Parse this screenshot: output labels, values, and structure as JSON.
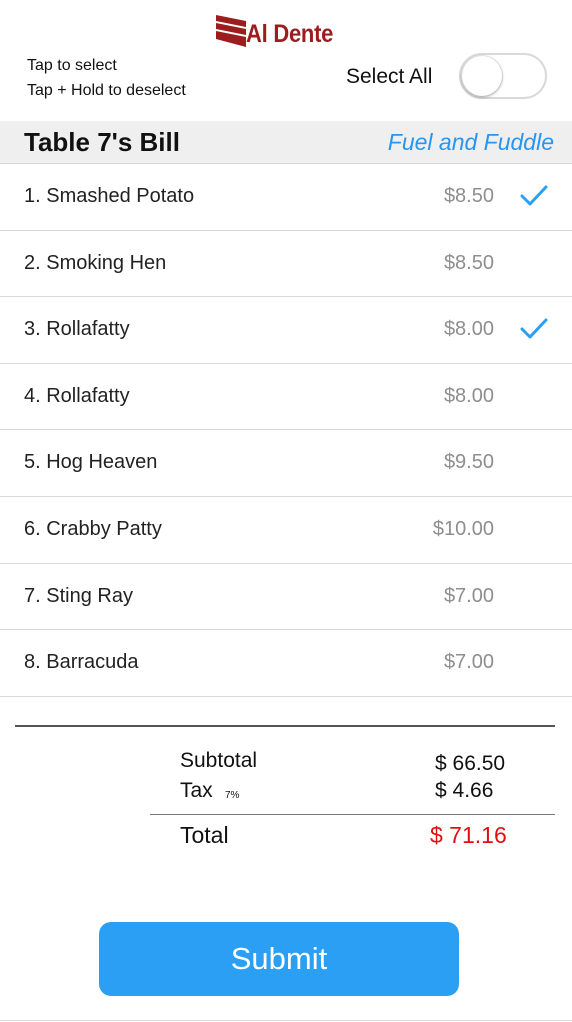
{
  "brand": {
    "name": "Al Dente",
    "color": "#9b1d1d"
  },
  "hints": {
    "select": "Tap to select",
    "deselect": "Tap + Hold to deselect"
  },
  "select_all": {
    "label": "Select All",
    "on": false
  },
  "bill": {
    "title": "Table 7's Bill",
    "restaurant": "Fuel and Fuddle"
  },
  "items": [
    {
      "label": "1. Smashed Potato",
      "price": "$8.50",
      "selected": true
    },
    {
      "label": "2. Smoking Hen",
      "price": "$8.50",
      "selected": false
    },
    {
      "label": "3. Rollafatty",
      "price": "$8.00",
      "selected": true
    },
    {
      "label": "4. Rollafatty",
      "price": "$8.00",
      "selected": false
    },
    {
      "label": "5. Hog Heaven",
      "price": "$9.50",
      "selected": false
    },
    {
      "label": "6. Crabby Patty",
      "price": "$10.00",
      "selected": false
    },
    {
      "label": "7. Sting Ray",
      "price": "$7.00",
      "selected": false
    },
    {
      "label": "8. Barracuda",
      "price": "$7.00",
      "selected": false
    }
  ],
  "summary": {
    "subtotal_label": "Subtotal",
    "subtotal_value": "$ 66.50",
    "tax_label": "Tax",
    "tax_rate": "7%",
    "tax_value": "$ 4.66",
    "total_label": "Total",
    "total_value": "$ 71.16"
  },
  "submit_label": "Submit",
  "icons": {
    "check": "checkmark-icon",
    "logo": "al-dente-logo-icon"
  },
  "colors": {
    "accent": "#2b9ff3",
    "restaurant": "#2a95ef",
    "total": "#e01010",
    "price": "#8e8e8e",
    "header_bg": "#efefef"
  }
}
